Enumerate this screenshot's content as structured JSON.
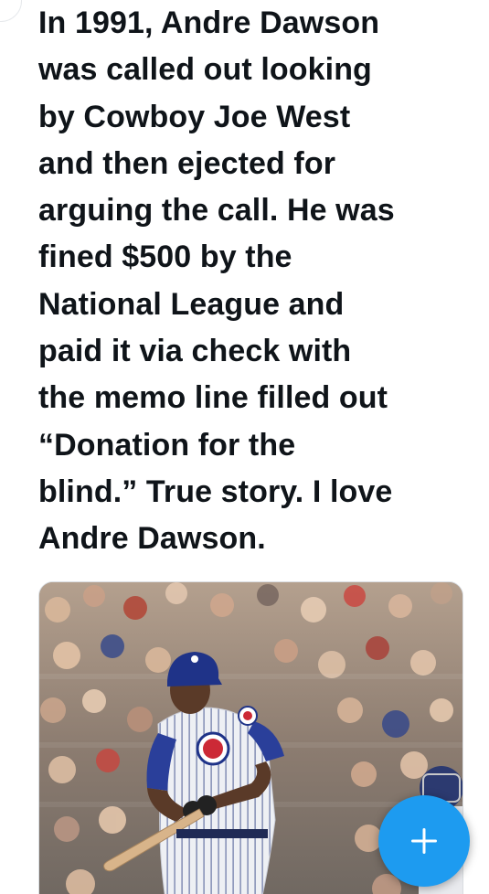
{
  "tweet": {
    "text_lines": [
      "In 1991, Andre Dawson",
      "was called out looking",
      "by Cowboy Joe West",
      "and then ejected for",
      "arguing the call. He was",
      "fined $500 by the",
      "National League and",
      "paid it via check with",
      "the memo line filled out",
      "“Donation for the",
      "blind.” True story. I love",
      "Andre Dawson."
    ]
  },
  "media": {
    "subject": "baseball player in pinstripe uniform swinging a bat in front of a stadium crowd"
  },
  "fab": {
    "icon": "plus-icon",
    "color": "#1d9bf0"
  },
  "colors": {
    "text": "#0f1419",
    "accent": "#1d9bf0"
  }
}
